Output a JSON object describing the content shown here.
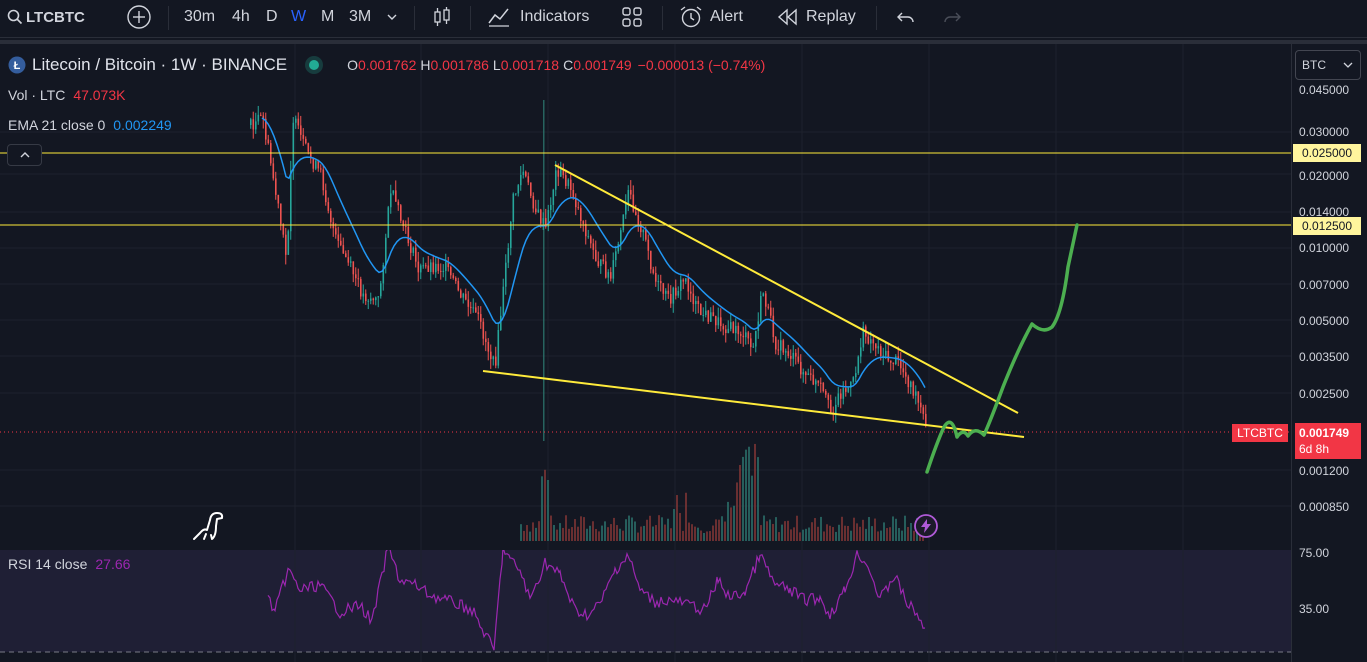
{
  "toolbar": {
    "symbol": "LTCBTC",
    "timeframes": [
      "30m",
      "4h",
      "D",
      "W",
      "M",
      "3M"
    ],
    "active_timeframe": "W",
    "indicators_label": "Indicators",
    "alert_label": "Alert",
    "replay_label": "Replay"
  },
  "legend": {
    "title": "Litecoin / Bitcoin · 1W · BINANCE",
    "open_label": "O",
    "open": "0.001762",
    "high_label": "H",
    "high": "0.001786",
    "low_label": "L",
    "low": "0.001718",
    "close_label": "C",
    "close": "0.001749",
    "change": "−0.000013 (−0.74%)",
    "vol_label": "Vol · LTC",
    "vol_value": "47.073K",
    "ema_label": "EMA 21 close 0",
    "ema_value": "0.002249"
  },
  "price_scale": {
    "currency": "BTC",
    "ticks": [
      "0.045000",
      "0.030000",
      "0.020000",
      "0.014000",
      "0.010000",
      "0.007000",
      "0.005000",
      "0.003500",
      "0.002500",
      "0.001200",
      "0.000850"
    ],
    "line_labels": [
      "0.025000",
      "0.012500"
    ],
    "last_price": "0.001749",
    "countdown": "6d 8h",
    "symbol_tag": "LTCBTC"
  },
  "rsi": {
    "label": "RSI 14 close",
    "value": "27.66",
    "ticks": [
      "75.00",
      "35.00"
    ]
  },
  "colors": {
    "background": "#131722",
    "up": "#26a69a",
    "down": "#ef5350",
    "ema": "#2196f3",
    "rsi": "#9c27b0",
    "trendline": "#ffeb3b",
    "projection": "#4caf50",
    "accent": "#2962ff"
  },
  "icons": [
    "search-icon",
    "add-symbol-icon",
    "chevron-down-icon",
    "candles-icon",
    "indicators-icon",
    "layouts-icon",
    "alert-icon",
    "replay-icon",
    "undo-icon",
    "redo-icon",
    "litecoin-icon",
    "chevron-up-icon",
    "dinosaur-icon",
    "lightning-icon"
  ]
}
